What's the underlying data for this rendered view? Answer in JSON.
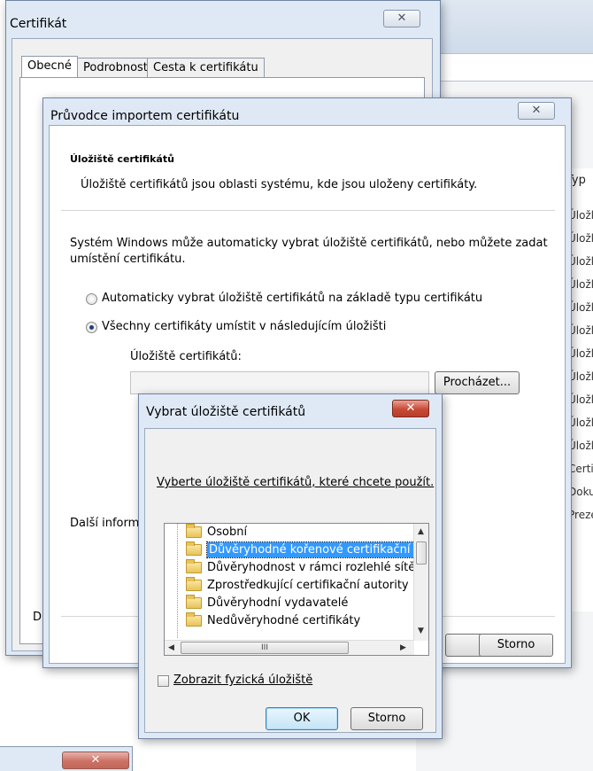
{
  "background_list": {
    "column_header": "Typ",
    "rows": [
      "Úložk",
      "Úložk",
      "Úložk",
      "Úložk",
      "Úložk",
      "Úložk",
      "Úložk",
      "Úložk",
      "Úložk",
      "Úložk",
      "Úložk",
      "Certi",
      "Doku",
      "Preze"
    ]
  },
  "cert_window": {
    "title": "Certifikát",
    "close_label": "✕",
    "tabs": [
      "Obecné",
      "Podrobnosti",
      "Cesta k certifikátu"
    ],
    "side_letter": "D"
  },
  "wizard": {
    "title": "Průvodce importem certifikátu",
    "close_label": "✕",
    "section_title": "Úložiště certifikátů",
    "section_desc": "Úložiště certifikátů jsou oblasti systému, kde jsou uloženy certifikáty.",
    "intro_line1": "Systém Windows může automaticky vybrat úložiště certifikátů, nebo můžete zadat",
    "intro_line2": "umístění certifikátu.",
    "radio_auto": "Automaticky vybrat úložiště certifikátů na základě typu certifikátu",
    "radio_manual": "Všechny certifikáty umístit v následujícím úložišti",
    "store_label": "Úložiště certifikátů:",
    "store_value": "",
    "browse_button": "Procházet...",
    "more_info": "Další informace",
    "cancel_button": "Storno"
  },
  "select_store": {
    "title": "Vybrat úložiště certifikátů",
    "close_label": "✕",
    "prompt": "Vyberte úložiště certifikátů, které chcete použít.",
    "stores": [
      "Osobní",
      "Důvěryhodné kořenové certifikační autor",
      "Důvěryhodnost v rámci rozlehlé sítě",
      "Zprostředkující certifikační autority",
      "Důvěryhodní vydavatelé",
      "Nedůvěryhodné certifikáty"
    ],
    "selected_index": 1,
    "hscroll_thumb": "III",
    "show_physical": "Zobrazit fyzická úložiště",
    "ok_button": "OK",
    "cancel_button": "Storno"
  },
  "bottom_fragment": {
    "close_label": "✕"
  }
}
